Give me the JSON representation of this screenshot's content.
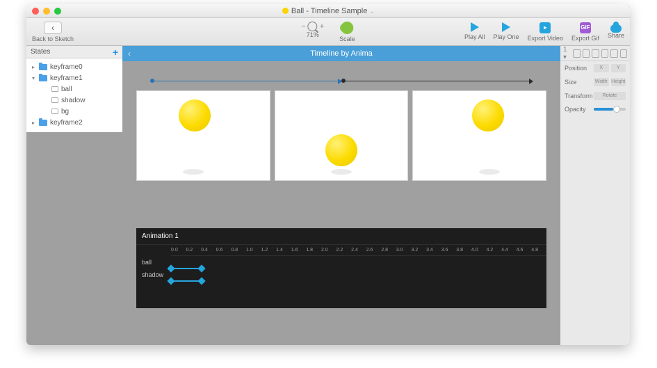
{
  "title": "Ball - Timeline Sample",
  "toolbar": {
    "back_label": "Back to Sketch",
    "zoom_level": "71%",
    "scale_label": "Scale",
    "play_all": "Play All",
    "play_one": "Play One",
    "export_video": "Export Video",
    "export_gif": "Export Gif",
    "share": "Share"
  },
  "states": {
    "header": "States",
    "items": [
      {
        "label": "keyframe0"
      },
      {
        "label": "keyframe1"
      },
      {
        "label": "ball"
      },
      {
        "label": "shadow"
      },
      {
        "label": "bg"
      },
      {
        "label": "keyframe2"
      }
    ]
  },
  "timeline_header": "Timeline by Anima",
  "animation": {
    "title": "Animation 1",
    "ticks": [
      "0.0",
      "0.2",
      "0.4",
      "0.6",
      "0.8",
      "1.0",
      "1.2",
      "1.4",
      "1.6",
      "1.8",
      "2.0",
      "2.2",
      "2.4",
      "2.6",
      "2.8",
      "3.0",
      "3.2",
      "3.4",
      "3.6",
      "3.8",
      "4.0",
      "4.2",
      "4.4",
      "4.6",
      "4.8"
    ],
    "rows": [
      {
        "label": "ball"
      },
      {
        "label": "shadow"
      }
    ]
  },
  "inspector": {
    "position": "Position",
    "x": "X",
    "y": "Y",
    "size": "Size",
    "width": "Width",
    "height": "Height",
    "transform": "Transform",
    "rotate": "Rotate",
    "opacity": "Opacity"
  }
}
